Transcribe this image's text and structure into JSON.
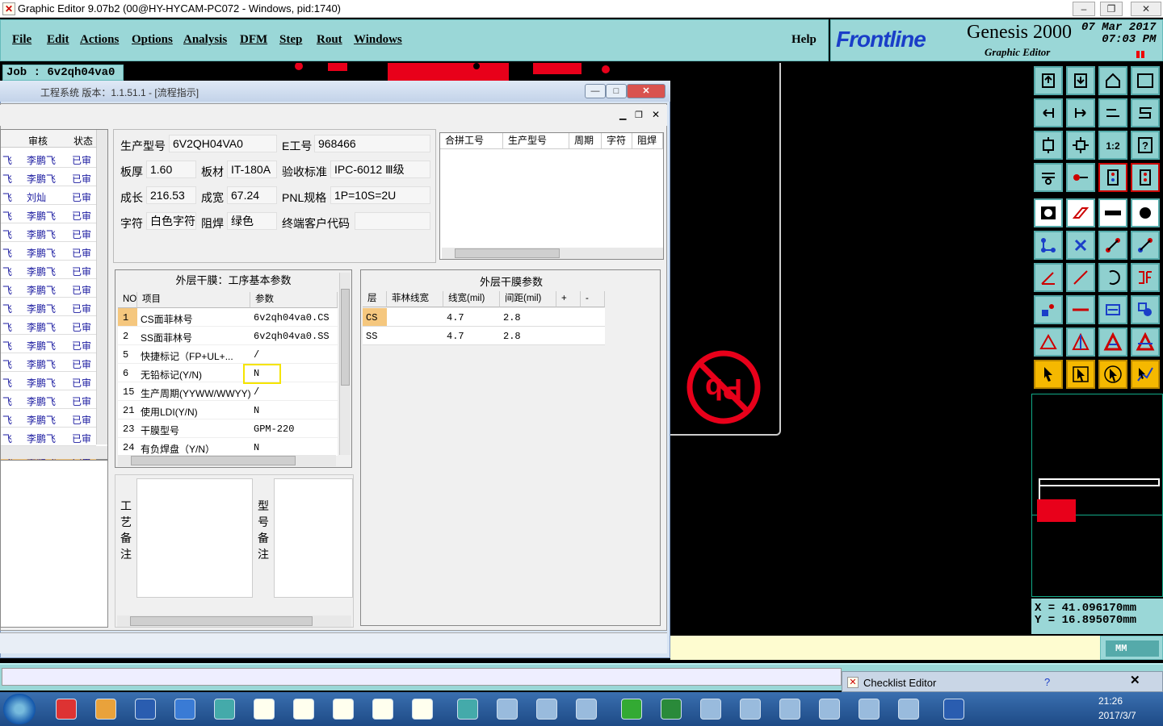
{
  "app": {
    "title": "Graphic Editor 9.07b2 (00@HY-HYCAM-PC072 - Windows, pid:1740)",
    "job_label": "Job  :  6v2qh04va0"
  },
  "menu": {
    "items": [
      "File",
      "Edit",
      "Actions",
      "Options",
      "Analysis",
      "DFM",
      "Step",
      "Rout",
      "Windows"
    ],
    "help": "Help"
  },
  "brand": {
    "logo": "Frontline",
    "product": "Genesis 2000",
    "subtitle": "Graphic Editor",
    "date": "07 Mar 2017",
    "time": "07:03  PM"
  },
  "coords": {
    "x": "X  =  41.096170mm",
    "y": "Y  =  16.895070mm"
  },
  "units": "MM",
  "dialog": {
    "title": "工程系统   版本：1.1.51.1 - [流程指示]",
    "list_headers": [
      "审核",
      "状态"
    ],
    "list_rows": [
      {
        "name": "李鹏飞",
        "status": "已审"
      },
      {
        "name": "李鹏飞",
        "status": "已审"
      },
      {
        "name": "刘灿",
        "status": "已审"
      },
      {
        "name": "李鹏飞",
        "status": "已审"
      },
      {
        "name": "李鹏飞",
        "status": "已审"
      },
      {
        "name": "李鹏飞",
        "status": "已审"
      },
      {
        "name": "李鹏飞",
        "status": "已审"
      },
      {
        "name": "李鹏飞",
        "status": "已审"
      },
      {
        "name": "李鹏飞",
        "status": "已审"
      },
      {
        "name": "李鹏飞",
        "status": "已审"
      },
      {
        "name": "李鹏飞",
        "status": "已审"
      },
      {
        "name": "李鹏飞",
        "status": "已审"
      },
      {
        "name": "李鹏飞",
        "status": "已审"
      },
      {
        "name": "李鹏飞",
        "status": "已审"
      },
      {
        "name": "李鹏飞",
        "status": "已审"
      },
      {
        "name": "李鹏飞",
        "status": "已审"
      },
      {
        "name": "李鹏飞",
        "status": "已审"
      }
    ],
    "info": {
      "model_label": "生产型号",
      "model": "6V2QH04VA0",
      "eno_label": "E工号",
      "eno": "968466",
      "thick_label": "板厚",
      "thick": "1.60",
      "mat_label": "板材",
      "mat": "IT-180A",
      "std_label": "验收标准",
      "std": "IPC-6012 Ⅲ级",
      "len_label": "成长",
      "len": "216.53",
      "wid_label": "成宽",
      "wid": "67.24",
      "pnl_label": "PNL规格",
      "pnl": "1P=10S=2U",
      "char_label": "字符",
      "char": "白色字符",
      "mask_label": "阻焊",
      "mask": "绿色",
      "cust_label": "终端客户代码",
      "cust": ""
    },
    "combo_headers": [
      "合拼工号",
      "生产型号",
      "周期",
      "字符",
      "阻焊"
    ],
    "params_title": "外层干膜：工序基本参数",
    "params_headers": [
      "NO",
      "项目",
      "参数"
    ],
    "params_rows": [
      {
        "no": "1",
        "item": "CS面菲林号",
        "val": "6v2qh04va0.CS"
      },
      {
        "no": "2",
        "item": "SS面菲林号",
        "val": "6v2qh04va0.SS"
      },
      {
        "no": "5",
        "item": "快捷标记（FP+UL+...",
        "val": "/"
      },
      {
        "no": "6",
        "item": "无铅标记(Y/N)",
        "val": "N"
      },
      {
        "no": "15",
        "item": "生产周期(YYWW/WWYY)",
        "val": "/"
      },
      {
        "no": "21",
        "item": "使用LDI(Y/N)",
        "val": "N"
      },
      {
        "no": "23",
        "item": "干膜型号",
        "val": "GPM-220"
      },
      {
        "no": "24",
        "item": "有负焊盘（Y/N）",
        "val": "N"
      }
    ],
    "film_title": "外层干膜参数",
    "film_headers": [
      "层",
      "菲林线宽",
      "线宽(mil)",
      "间距(mil)",
      "+",
      "-"
    ],
    "film_rows": [
      {
        "layer": "CS",
        "fw": "",
        "lw": "4.7",
        "sp": "2.8"
      },
      {
        "layer": "SS",
        "fw": "",
        "lw": "4.7",
        "sp": "2.8"
      }
    ],
    "notes_label_1": "工艺备注",
    "notes_label_2": "型号备注"
  },
  "checklist": {
    "title": "Checklist Editor"
  },
  "clock": {
    "time": "21:26",
    "date": "2017/3/7"
  },
  "colors": {
    "panel": "#9ad7d7",
    "accent_red": "#e8001a",
    "highlight": "#f5e400"
  }
}
